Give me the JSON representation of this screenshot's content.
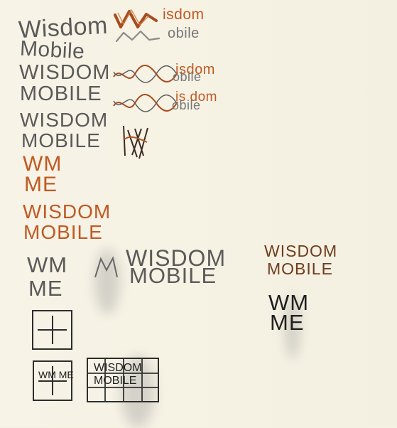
{
  "sketches": {
    "left_top_1": "Wisdom",
    "left_top_2": "Mobile",
    "left_mid_1": "WISDOM",
    "left_mid_2": "MOBILE",
    "left_mid_3": "WISDOM",
    "left_mid_4": "MOBILE",
    "left_wm_1": "WM",
    "left_wm_2": "ME",
    "left_orange_1": "WISDOM",
    "left_orange_2": "MOBILE",
    "left_bottom_1": "WM",
    "left_bottom_2": "ME",
    "top_orange_word": "isdom",
    "top_gray_word": "obile",
    "wave_word_1a": "isdom",
    "wave_word_1b": "obile",
    "wave_word_2a": "is dom",
    "wave_word_2b": "obile",
    "center_1": "WISDOM",
    "center_2": "MOBILE",
    "right_1": "WISDOM",
    "right_2": "MOBILE",
    "right_wm_1": "WM",
    "right_wm_2": "ME",
    "grid_1": "WISDOM",
    "grid_2": "MOBILE",
    "small_box": "WM ME"
  }
}
